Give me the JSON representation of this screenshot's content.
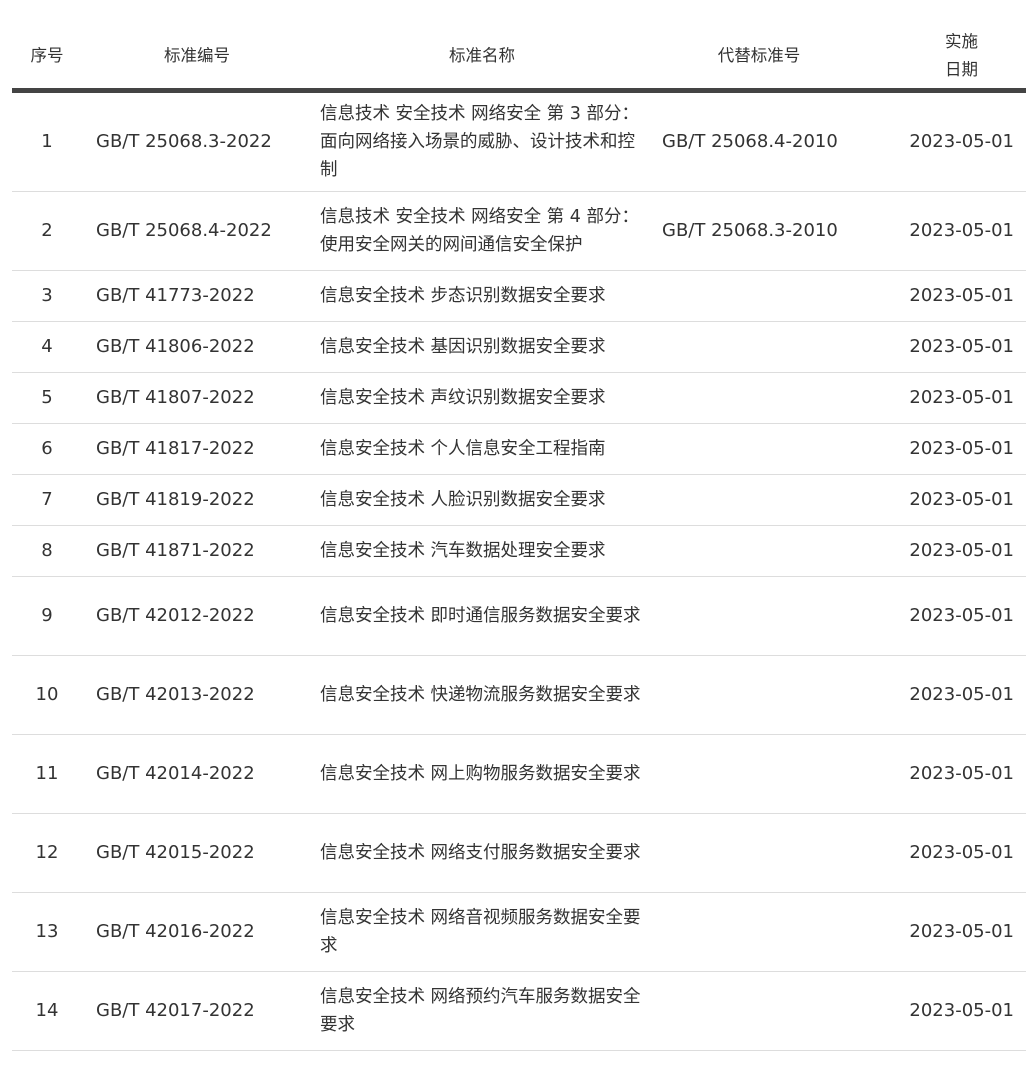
{
  "headers": {
    "seq": "序号",
    "code": "标准编号",
    "name": "标准名称",
    "replaces": "代替标准号",
    "date_line1": "实施",
    "date_line2": "日期"
  },
  "rows": [
    {
      "seq": "1",
      "code": "GB/T 25068.3-2022",
      "name": "信息技术 安全技术 网络安全 第 3 部分：面向网络接入场景的威胁、设计技术和控制",
      "replaces": "GB/T 25068.4-2010",
      "date": "2023-05-01"
    },
    {
      "seq": "2",
      "code": "GB/T 25068.4-2022",
      "name": "信息技术 安全技术 网络安全 第 4 部分：使用安全网关的网间通信安全保护",
      "replaces": "GB/T 25068.3-2010",
      "date": "2023-05-01"
    },
    {
      "seq": "3",
      "code": "GB/T 41773-2022",
      "name": "信息安全技术 步态识别数据安全要求",
      "replaces": "",
      "date": "2023-05-01"
    },
    {
      "seq": "4",
      "code": "GB/T 41806-2022",
      "name": "信息安全技术 基因识别数据安全要求",
      "replaces": "",
      "date": "2023-05-01"
    },
    {
      "seq": "5",
      "code": "GB/T 41807-2022",
      "name": "信息安全技术 声纹识别数据安全要求",
      "replaces": "",
      "date": "2023-05-01"
    },
    {
      "seq": "6",
      "code": "GB/T 41817-2022",
      "name": "信息安全技术 个人信息安全工程指南",
      "replaces": "",
      "date": "2023-05-01"
    },
    {
      "seq": "7",
      "code": "GB/T 41819-2022",
      "name": "信息安全技术 人脸识别数据安全要求",
      "replaces": "",
      "date": "2023-05-01"
    },
    {
      "seq": "8",
      "code": "GB/T 41871-2022",
      "name": "信息安全技术 汽车数据处理安全要求",
      "replaces": "",
      "date": "2023-05-01"
    },
    {
      "seq": "9",
      "code": "GB/T 42012-2022",
      "name": "信息安全技术 即时通信服务数据安全要求",
      "replaces": "",
      "date": "2023-05-01"
    },
    {
      "seq": "10",
      "code": "GB/T 42013-2022",
      "name": "信息安全技术 快递物流服务数据安全要求",
      "replaces": "",
      "date": "2023-05-01"
    },
    {
      "seq": "11",
      "code": "GB/T 42014-2022",
      "name": "信息安全技术 网上购物服务数据安全要求",
      "replaces": "",
      "date": "2023-05-01"
    },
    {
      "seq": "12",
      "code": "GB/T 42015-2022",
      "name": "信息安全技术 网络支付服务数据安全要求",
      "replaces": "",
      "date": "2023-05-01"
    },
    {
      "seq": "13",
      "code": "GB/T 42016-2022",
      "name": "信息安全技术 网络音视频服务数据安全要求",
      "replaces": "",
      "date": "2023-05-01"
    },
    {
      "seq": "14",
      "code": "GB/T 42017-2022",
      "name": "信息安全技术 网络预约汽车服务数据安全要求",
      "replaces": "",
      "date": "2023-05-01"
    }
  ]
}
